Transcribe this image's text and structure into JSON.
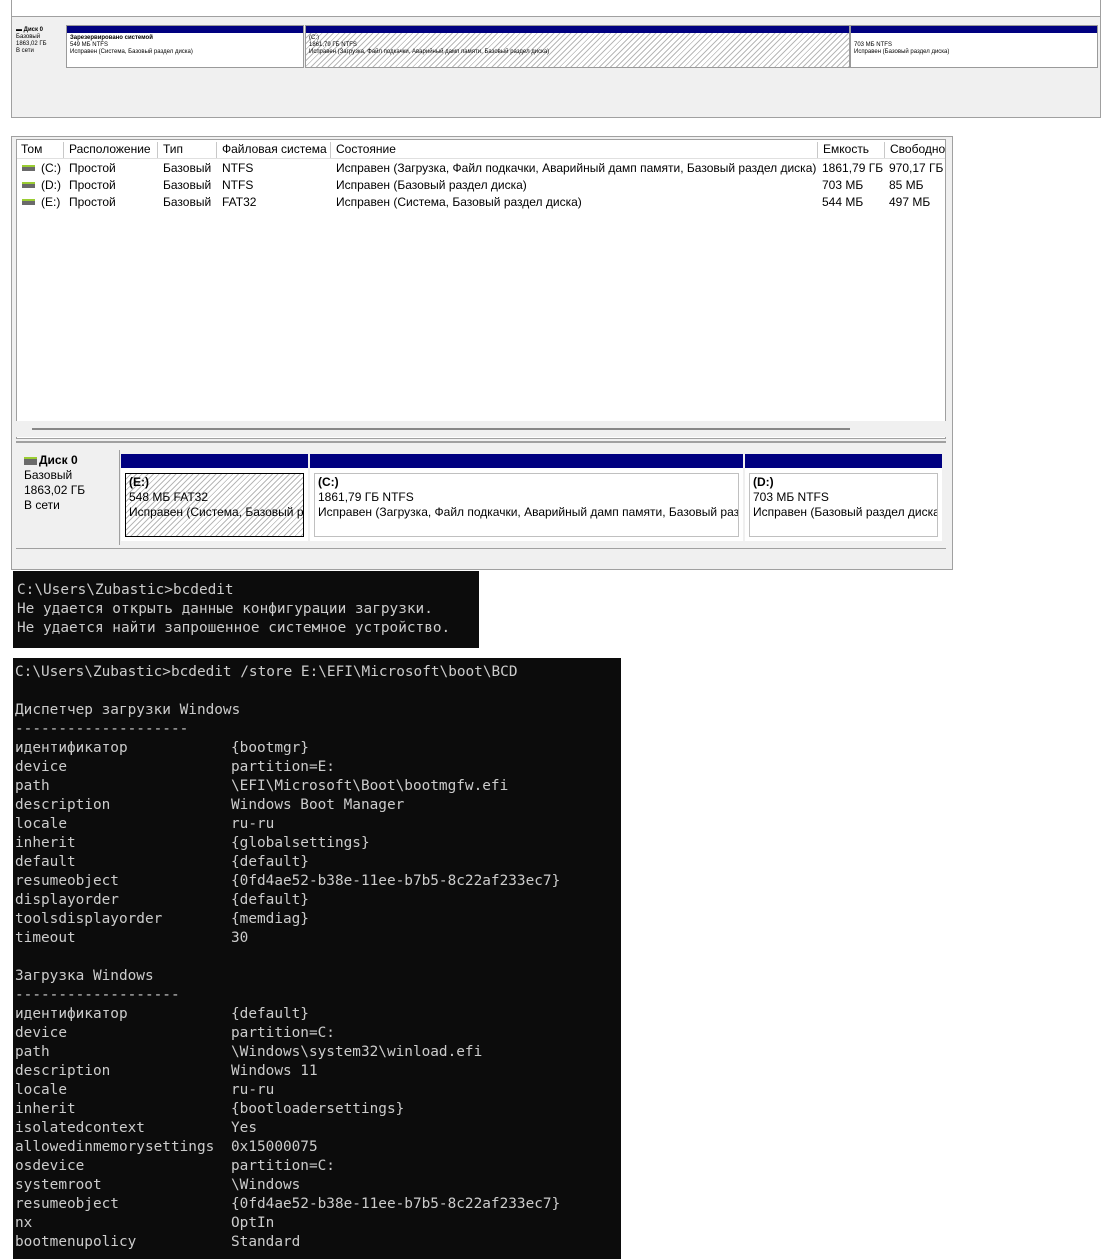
{
  "top_panel": {
    "disk": {
      "name": "Диск 0",
      "type": "Базовый",
      "size": "1863,02 ГБ",
      "status": "В сети"
    },
    "partitions": [
      {
        "name": "Зарезервировано системой",
        "size": "549 МБ NTFS",
        "status": "Исправен (Система, Базовый раздел диска)"
      },
      {
        "name": "(C:)",
        "size": "1861,79 ГБ NTFS",
        "status": "Исправен (Загрузка, Файл подкачки, Аварийный дамп памяти, Базовый раздел диска)"
      },
      {
        "name": "",
        "size": "703 МБ NTFS",
        "status": "Исправен (Базовый раздел диска)"
      }
    ]
  },
  "volume_list": {
    "columns": [
      "Том",
      "Расположение",
      "Тип",
      "Файловая система",
      "Состояние",
      "Емкость",
      "Свободно"
    ],
    "rows": [
      [
        "(C:)",
        "Простой",
        "Базовый",
        "NTFS",
        "Исправен (Загрузка, Файл подкачки, Аварийный дамп памяти, Базовый раздел диска)",
        "1861,79 ГБ",
        "970,17 ГБ"
      ],
      [
        "(D:)",
        "Простой",
        "Базовый",
        "NTFS",
        "Исправен (Базовый раздел диска)",
        "703 МБ",
        "85 МБ"
      ],
      [
        "(E:)",
        "Простой",
        "Базовый",
        "FAT32",
        "Исправен (Система, Базовый раздел диска)",
        "544 МБ",
        "497 МБ"
      ]
    ]
  },
  "disk_map": {
    "disk": {
      "name": "Диск 0",
      "type": "Базовый",
      "size": "1863,02 ГБ",
      "status": "В сети"
    },
    "partitions": [
      {
        "name": "(E:)",
        "size": "548 МБ FAT32",
        "status": "Исправен (Система, Базовый раздел диска)"
      },
      {
        "name": "(C:)",
        "size": "1861,79 ГБ NTFS",
        "status": "Исправен (Загрузка, Файл подкачки, Аварийный дамп памяти, Базовый раздел диска)"
      },
      {
        "name": "(D:)",
        "size": "703 МБ NTFS",
        "status": "Исправен (Базовый раздел диска)"
      }
    ]
  },
  "console1": {
    "lines": [
      "C:\\Users\\Zubastic>bcdedit",
      "Не удается открыть данные конфигурации загрузки.",
      "Не удается найти запрошенное системное устройство."
    ]
  },
  "console2": {
    "command": "C:\\Users\\Zubastic>bcdedit /store E:\\EFI\\Microsoft\\boot\\BCD",
    "section1": {
      "title": "Диспетчер загрузки Windows",
      "underline": "--------------------",
      "entries": [
        [
          "идентификатор",
          "{bootmgr}"
        ],
        [
          "device",
          "partition=E:"
        ],
        [
          "path",
          "\\EFI\\Microsoft\\Boot\\bootmgfw.efi"
        ],
        [
          "description",
          "Windows Boot Manager"
        ],
        [
          "locale",
          "ru-ru"
        ],
        [
          "inherit",
          "{globalsettings}"
        ],
        [
          "default",
          "{default}"
        ],
        [
          "resumeobject",
          "{0fd4ae52-b38e-11ee-b7b5-8c22af233ec7}"
        ],
        [
          "displayorder",
          "{default}"
        ],
        [
          "toolsdisplayorder",
          "{memdiag}"
        ],
        [
          "timeout",
          "30"
        ]
      ]
    },
    "section2": {
      "title": "Загрузка Windows",
      "underline": "-------------------",
      "entries": [
        [
          "идентификатор",
          "{default}"
        ],
        [
          "device",
          "partition=C:"
        ],
        [
          "path",
          "\\Windows\\system32\\winload.efi"
        ],
        [
          "description",
          "Windows 11"
        ],
        [
          "locale",
          "ru-ru"
        ],
        [
          "inherit",
          "{bootloadersettings}"
        ],
        [
          "isolatedcontext",
          "Yes"
        ],
        [
          "allowedinmemorysettings",
          "0x15000075"
        ],
        [
          "osdevice",
          "partition=C:"
        ],
        [
          "systemroot",
          "\\Windows"
        ],
        [
          "resumeobject",
          "{0fd4ae52-b38e-11ee-b7b5-8c22af233ec7}"
        ],
        [
          "nx",
          "OptIn"
        ],
        [
          "bootmenupolicy",
          "Standard"
        ]
      ]
    }
  }
}
